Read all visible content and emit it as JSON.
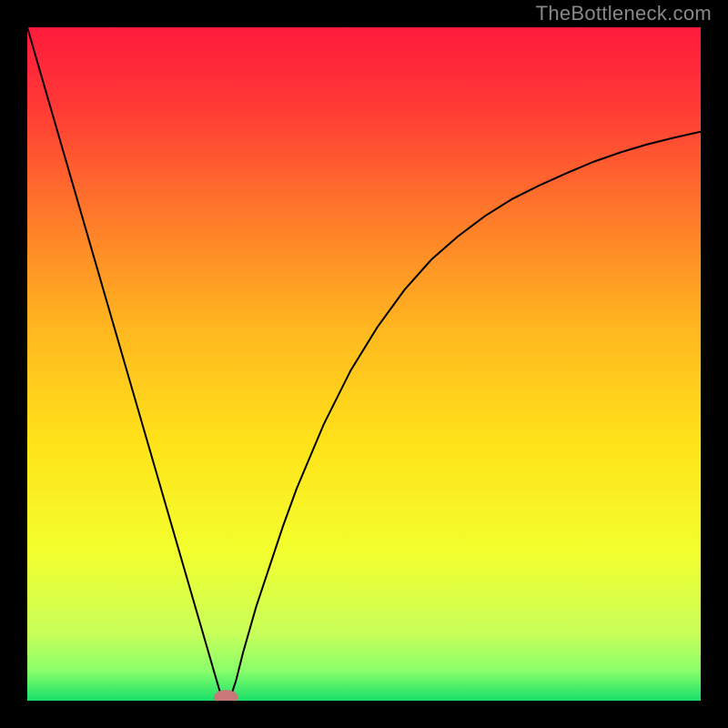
{
  "watermark": "TheBottleneck.com",
  "chart_data": {
    "type": "line",
    "title": "",
    "xlabel": "",
    "ylabel": "",
    "xlim": [
      0,
      100
    ],
    "ylim": [
      0,
      100
    ],
    "background_gradient": {
      "stops": [
        {
          "offset": 0.0,
          "color": "#ff1a3c"
        },
        {
          "offset": 0.12,
          "color": "#ff3a35"
        },
        {
          "offset": 0.28,
          "color": "#ff7a2a"
        },
        {
          "offset": 0.45,
          "color": "#ffb81f"
        },
        {
          "offset": 0.62,
          "color": "#ffe31a"
        },
        {
          "offset": 0.78,
          "color": "#f3ff2e"
        },
        {
          "offset": 0.9,
          "color": "#c8ff5a"
        },
        {
          "offset": 0.955,
          "color": "#8aff6a"
        },
        {
          "offset": 1.0,
          "color": "#18e06a"
        }
      ]
    },
    "curve": {
      "color": "#000000",
      "width": 2,
      "x": [
        0,
        2,
        4,
        6,
        8,
        10,
        12,
        14,
        16,
        18,
        20,
        22,
        24,
        26,
        28,
        29,
        30,
        31,
        32,
        34,
        36,
        38,
        40,
        44,
        48,
        52,
        56,
        60,
        64,
        68,
        72,
        76,
        80,
        84,
        88,
        92,
        96,
        100
      ],
      "y": [
        100,
        93.1,
        86.2,
        79.3,
        72.4,
        65.5,
        58.6,
        51.7,
        44.8,
        37.9,
        31.0,
        24.1,
        17.2,
        10.3,
        3.4,
        0.0,
        0.0,
        3.0,
        7.0,
        14.0,
        20.0,
        26.0,
        31.5,
        41.0,
        49.0,
        55.5,
        61.0,
        65.5,
        69.0,
        72.0,
        74.5,
        76.5,
        78.3,
        80.0,
        81.4,
        82.6,
        83.6,
        84.5
      ]
    },
    "marker": {
      "x": 29.5,
      "y": 0.5,
      "rx": 1.8,
      "ry": 1.1,
      "color": "#c87878"
    }
  }
}
